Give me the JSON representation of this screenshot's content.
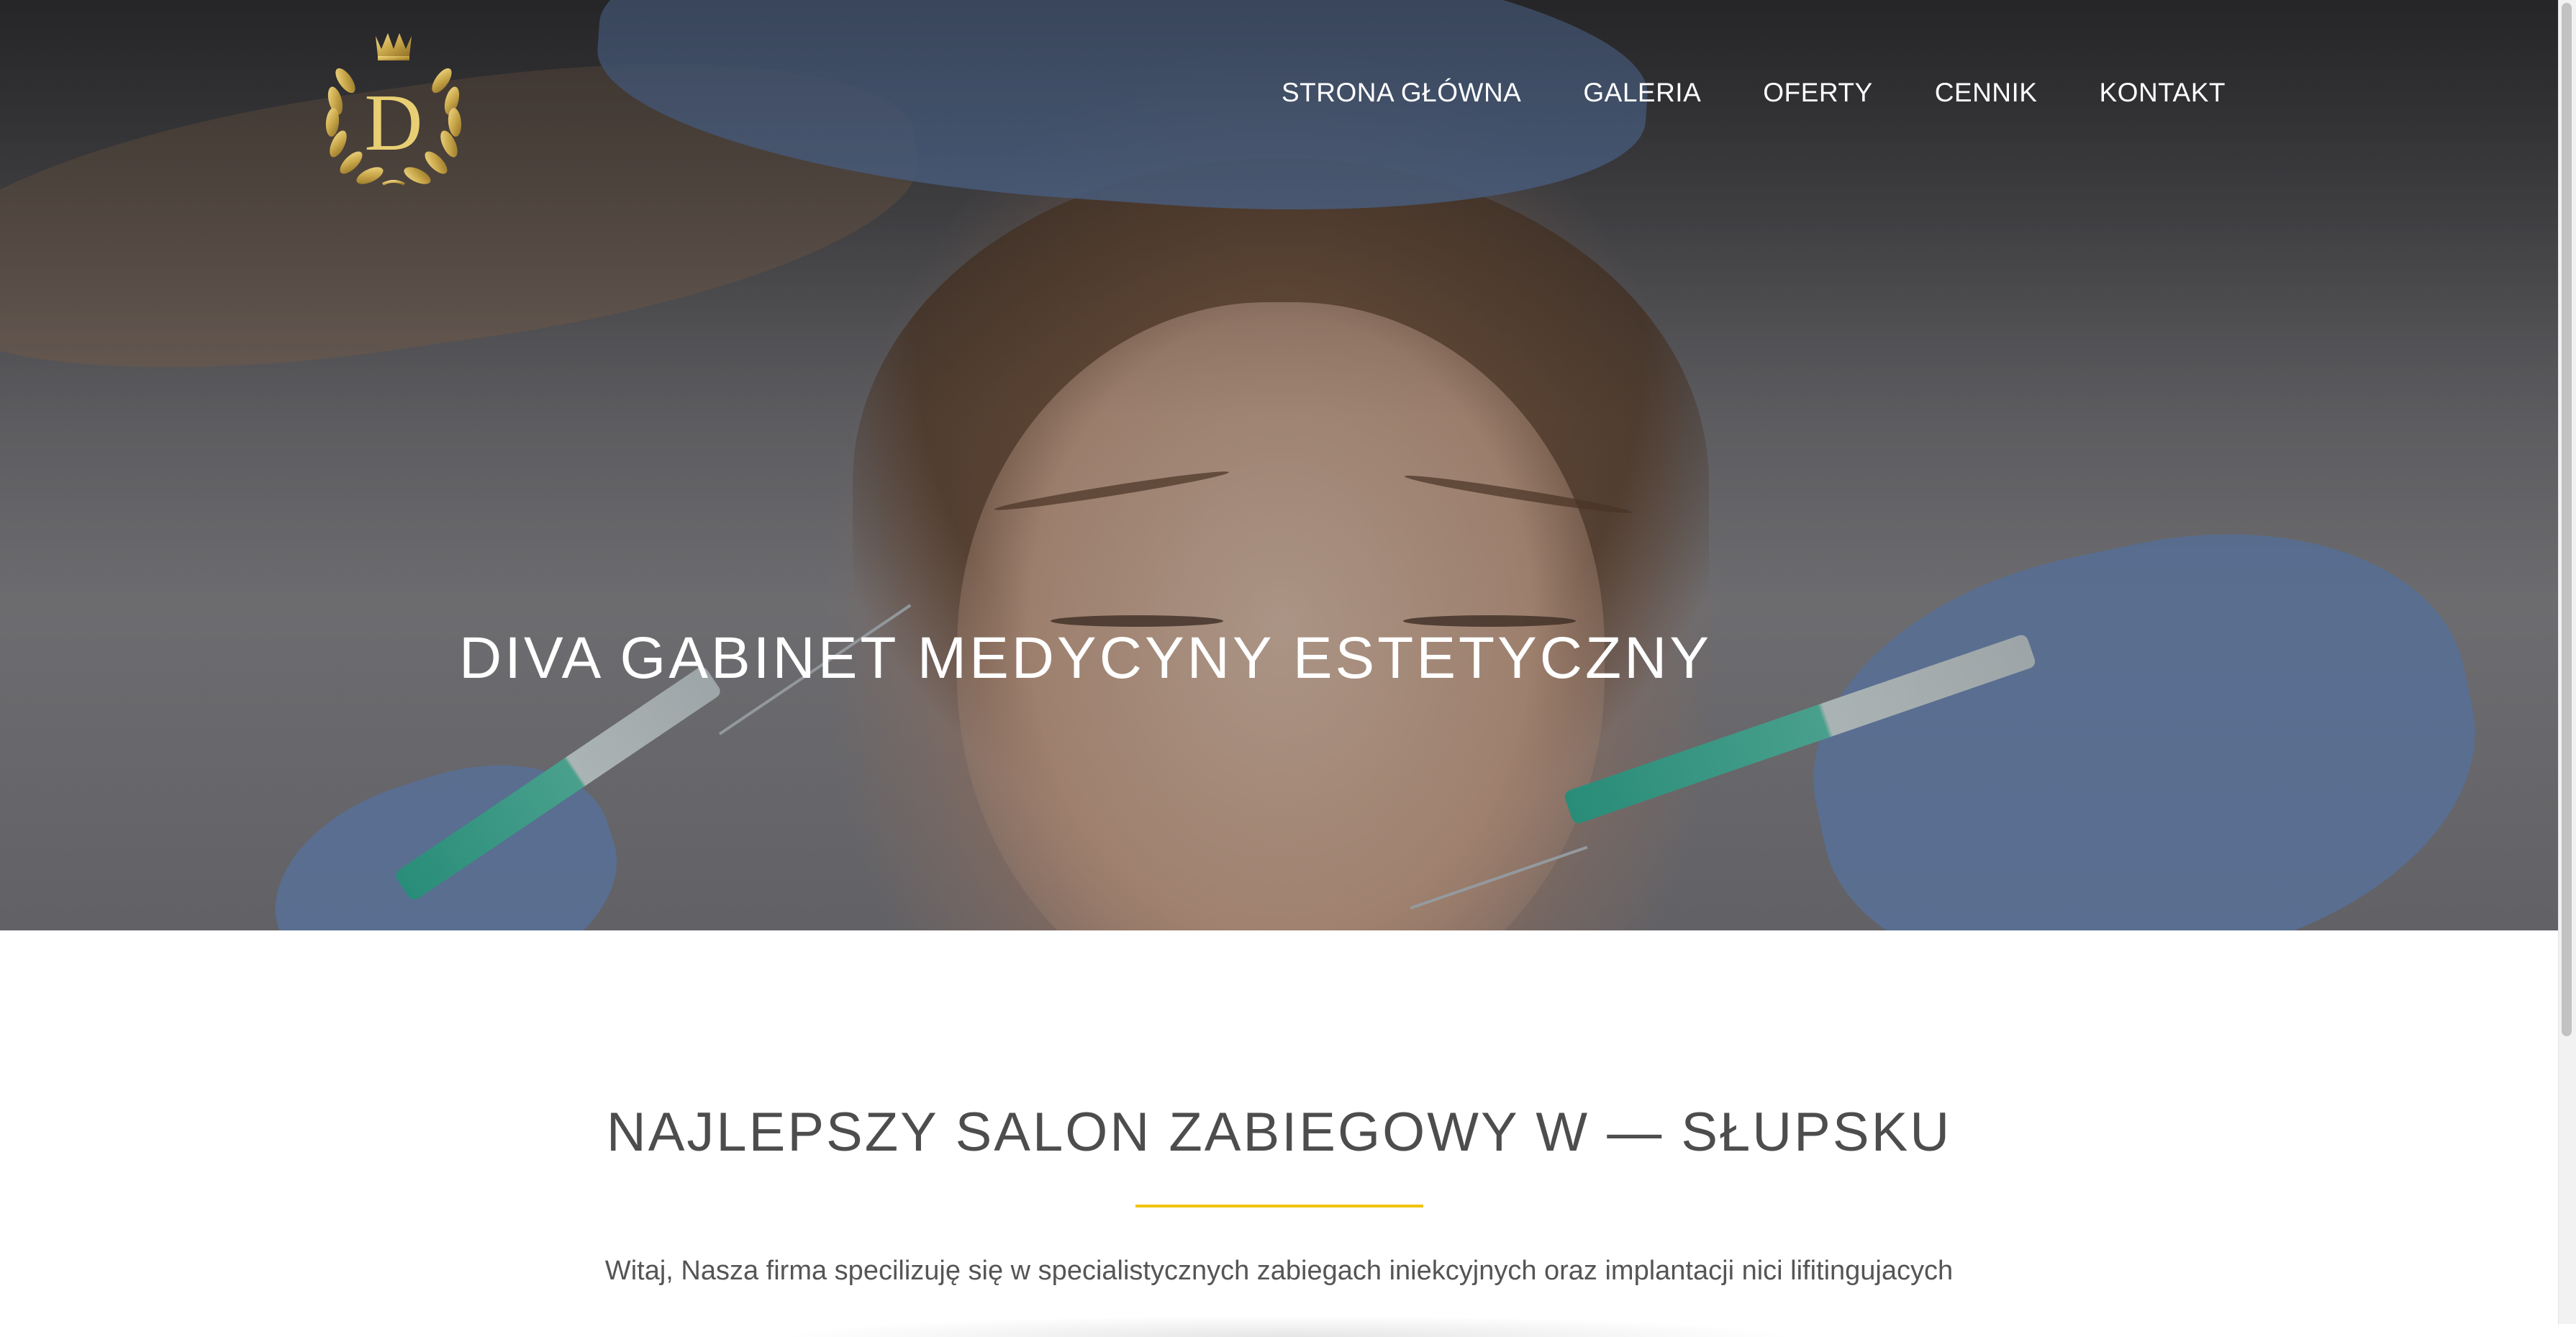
{
  "brand": {
    "logo_letter": "D",
    "logo_color": "#c9a74a"
  },
  "nav": {
    "items": [
      {
        "label": "STRONA GŁÓWNA"
      },
      {
        "label": "GALERIA"
      },
      {
        "label": "OFERTY"
      },
      {
        "label": "CENNIK"
      },
      {
        "label": "KONTAKT"
      }
    ]
  },
  "hero": {
    "title": "DIVA GABINET MEDYCYNY ESTETYCZNY"
  },
  "main": {
    "title": "NAJLEPSZY SALON ZABIEGOWY W — SŁUPSKU",
    "intro": "Witaj, Nasza firma specilizuję się w specialistycznych zabiegach iniekcyjnych oraz implantacji nici lifitingujacych",
    "accent_color": "#f1c40f"
  }
}
